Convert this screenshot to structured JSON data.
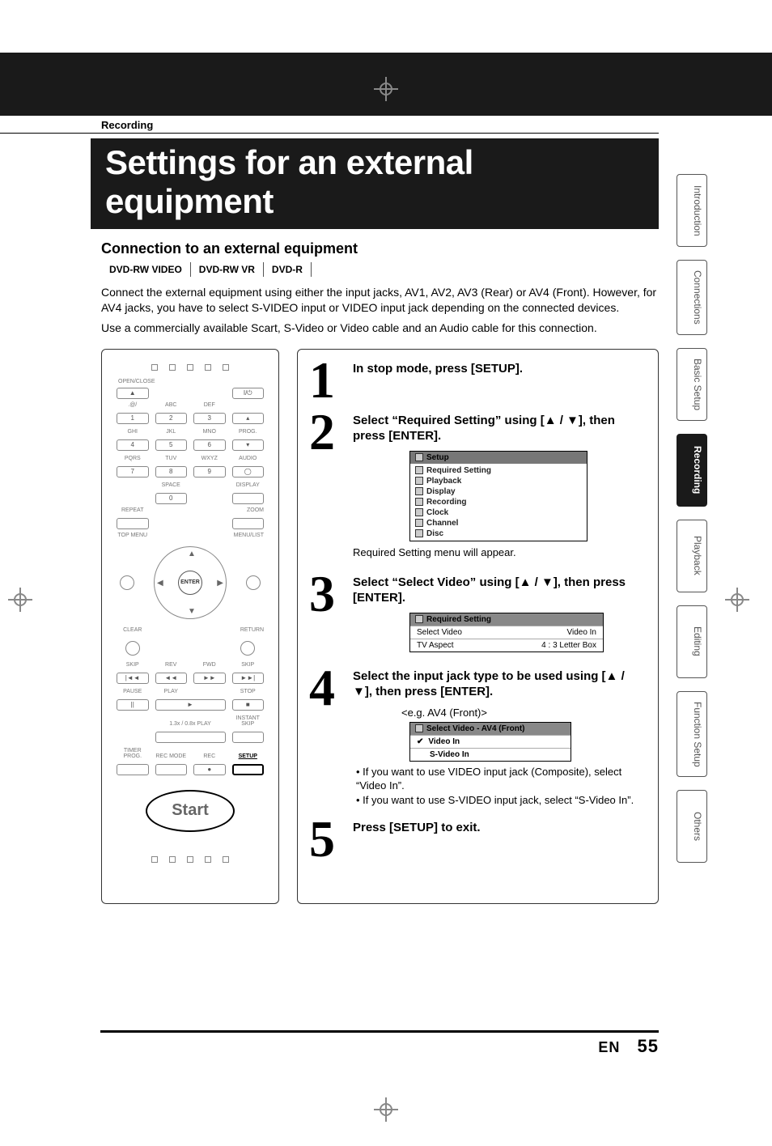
{
  "section_label": "Recording",
  "page_title": "Settings for an external equipment",
  "subsection": "Connection to an external equipment",
  "media_types": [
    "DVD-RW VIDEO",
    "DVD-RW VR",
    "DVD-R"
  ],
  "intro": [
    "Connect the external equipment using either the input jacks, AV1, AV2, AV3 (Rear) or AV4 (Front). However, for AV4 jacks, you have to select S-VIDEO input or VIDEO input jack depending on the connected devices.",
    "Use a commercially available Scart, S-Video or Video cable and an Audio cable for this connection."
  ],
  "remote": {
    "start_label": "Start",
    "enter_label": "ENTER",
    "row_labels": [
      [
        "OPEN/CLOSE",
        "",
        "",
        "I/⏻"
      ],
      [
        ".@/",
        "ABC",
        "DEF",
        ""
      ],
      [
        "GHI",
        "JKL",
        "MNO",
        "PROG."
      ],
      [
        "PQRS",
        "TUV",
        "WXYZ",
        "AUDIO"
      ],
      [
        "",
        "SPACE",
        "",
        "DISPLAY"
      ],
      [
        "REPEAT",
        "",
        "",
        "ZOOM"
      ],
      [
        "TOP MENU",
        "",
        "",
        "MENU/LIST"
      ],
      [
        "CLEAR",
        "",
        "",
        "RETURN"
      ],
      [
        "SKIP",
        "REV",
        "FWD",
        "SKIP"
      ],
      [
        "PAUSE",
        "PLAY",
        "",
        "STOP"
      ],
      [
        "",
        "1.3x / 0.8x PLAY",
        "",
        "INSTANT SKIP"
      ],
      [
        "TIMER PROG.",
        "REC MODE",
        "REC",
        "SETUP"
      ]
    ]
  },
  "steps": [
    {
      "num": "1",
      "head": "In stop mode, press [SETUP]."
    },
    {
      "num": "2",
      "head": "Select “Required Setting” using [▲ / ▼], then press [ENTER].",
      "osd": {
        "title": "Setup",
        "items": [
          "Required Setting",
          "Playback",
          "Display",
          "Recording",
          "Clock",
          "Channel",
          "Disc"
        ]
      },
      "caption": "Required Setting menu will appear."
    },
    {
      "num": "3",
      "head": "Select “Select Video” using [▲ / ▼], then press [ENTER].",
      "osd2": {
        "title": "Required Setting",
        "rows": [
          {
            "l": "Select Video",
            "r": "Video In"
          },
          {
            "l": "TV Aspect",
            "r": "4 : 3 Letter Box"
          }
        ]
      }
    },
    {
      "num": "4",
      "head": "Select the input jack type to be used using [▲ / ▼], then press [ENTER].",
      "eg": "<e.g. AV4 (Front)>",
      "osd3": {
        "title": "Select Video - AV4 (Front)",
        "options": [
          "Video In",
          "S-Video In"
        ]
      },
      "notes": [
        "• If you want to use VIDEO input jack (Composite), select “Video In”.",
        "• If you want to use S-VIDEO input jack, select “S-Video In”."
      ]
    },
    {
      "num": "5",
      "head": "Press [SETUP] to exit."
    }
  ],
  "tabs": [
    "Introduction",
    "Connections",
    "Basic Setup",
    "Recording",
    "Playback",
    "Editing",
    "Function Setup",
    "Others"
  ],
  "active_tab": "Recording",
  "footer": {
    "lang": "EN",
    "page": "55"
  }
}
